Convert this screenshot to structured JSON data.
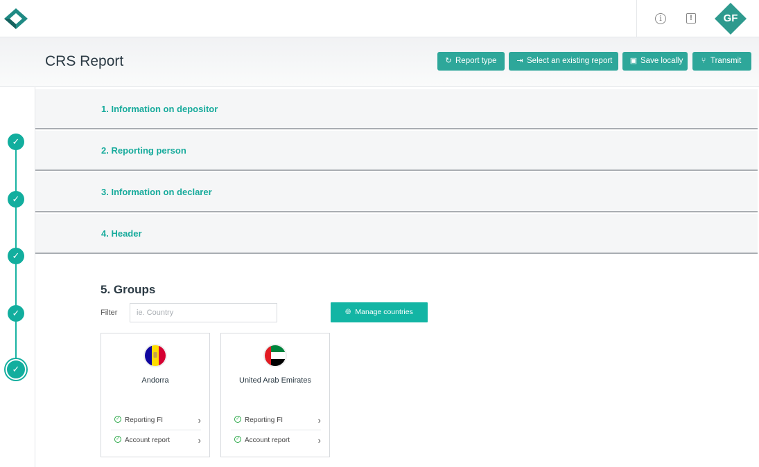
{
  "app": {
    "brand_color": "#2ea79a",
    "accent_color": "#13b5a4",
    "icons": [
      "logo-diamond-icon",
      "info-icon",
      "alert-icon"
    ]
  },
  "topbar": {
    "avatar_initials": "GF"
  },
  "header": {
    "title": "CRS Report",
    "buttons": [
      {
        "label": "Report type",
        "icon": "refresh-icon"
      },
      {
        "label": "Select an existing report",
        "icon": "file-import-icon"
      },
      {
        "label": "Save locally",
        "icon": "floppy-icon"
      },
      {
        "label": "Transmit",
        "icon": "share-nodes-icon"
      }
    ]
  },
  "stepper": {
    "steps": [
      {
        "state": "done"
      },
      {
        "state": "done"
      },
      {
        "state": "done"
      },
      {
        "state": "done"
      },
      {
        "state": "active"
      }
    ]
  },
  "sections": [
    {
      "label": "1. Information on depositor"
    },
    {
      "label": "2. Reporting person"
    },
    {
      "label": "3. Information on declarer"
    },
    {
      "label": "4. Header"
    }
  ],
  "groups": {
    "title": "5. Groups",
    "filter_label": "Filter",
    "filter_placeholder": "ie. Country",
    "filter_value": "",
    "manage_button": "Manage countries",
    "countries": [
      {
        "name": "Andorra",
        "flag": "andorra-flag",
        "items": [
          "Reporting FI",
          "Account report"
        ]
      },
      {
        "name": "United Arab Emirates",
        "flag": "uae-flag",
        "items": [
          "Reporting FI",
          "Account report"
        ]
      }
    ]
  }
}
